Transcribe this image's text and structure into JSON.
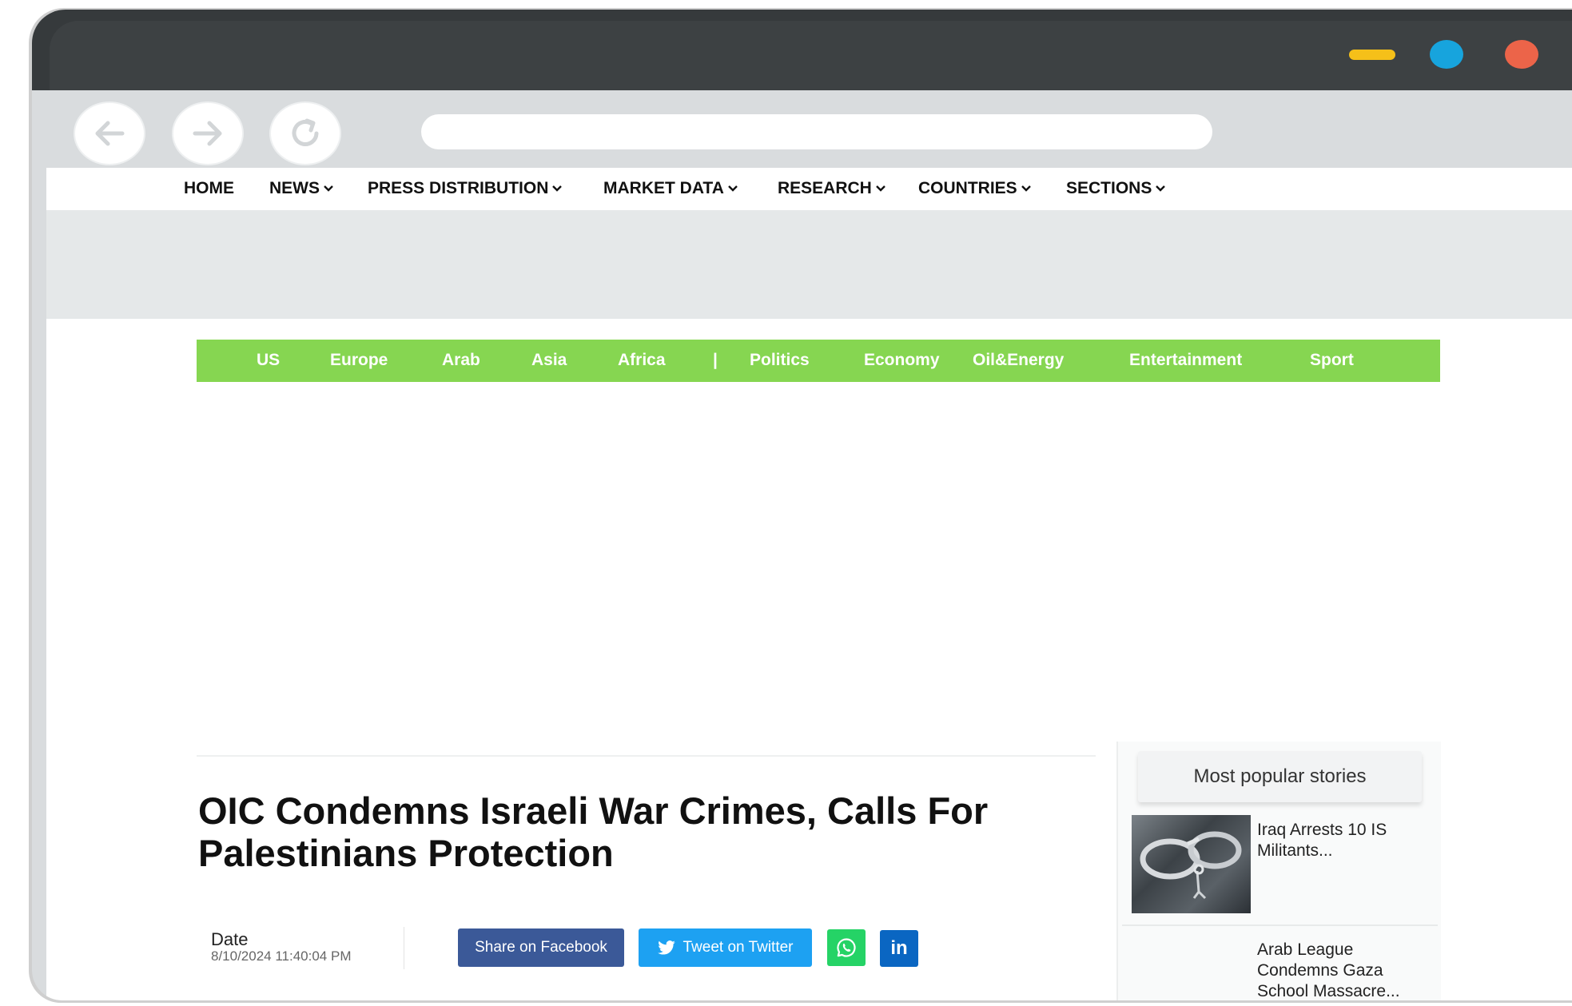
{
  "browser": {
    "address": "",
    "controls": {
      "minimize_color": "#f5c019",
      "maximize_color": "#17a4dd",
      "close_color": "#ec6449"
    }
  },
  "mainnav": [
    {
      "label": "HOME",
      "dropdown": false
    },
    {
      "label": "NEWS",
      "dropdown": true
    },
    {
      "label": "PRESS DISTRIBUTION",
      "dropdown": true
    },
    {
      "label": "MARKET DATA",
      "dropdown": true
    },
    {
      "label": "RESEARCH",
      "dropdown": true
    },
    {
      "label": "COUNTRIES",
      "dropdown": true
    },
    {
      "label": "SECTIONS",
      "dropdown": true
    }
  ],
  "subnav": {
    "color": "#86d651",
    "items": [
      "US",
      "Europe",
      "Arab",
      "Asia",
      "Africa",
      "|",
      "Politics",
      "Economy",
      "Oil&Energy",
      "Entertainment",
      "Sport"
    ]
  },
  "article": {
    "headline": "OIC Condemns Israeli War Crimes, Calls For Palestinians Protection",
    "date_label": "Date",
    "date_value": "8/10/2024 11:40:04 PM"
  },
  "share": {
    "facebook": "Share on Facebook",
    "twitter": "Tweet on Twitter",
    "whatsapp_icon": "whatsapp-icon",
    "linkedin": "in"
  },
  "sidebar": {
    "heading": "Most popular stories",
    "stories": [
      {
        "title": "Iraq Arrests 10 IS Militants...",
        "thumb": "handcuffs image"
      },
      {
        "title": "Arab League Condemns Gaza School Massacre..."
      }
    ]
  }
}
